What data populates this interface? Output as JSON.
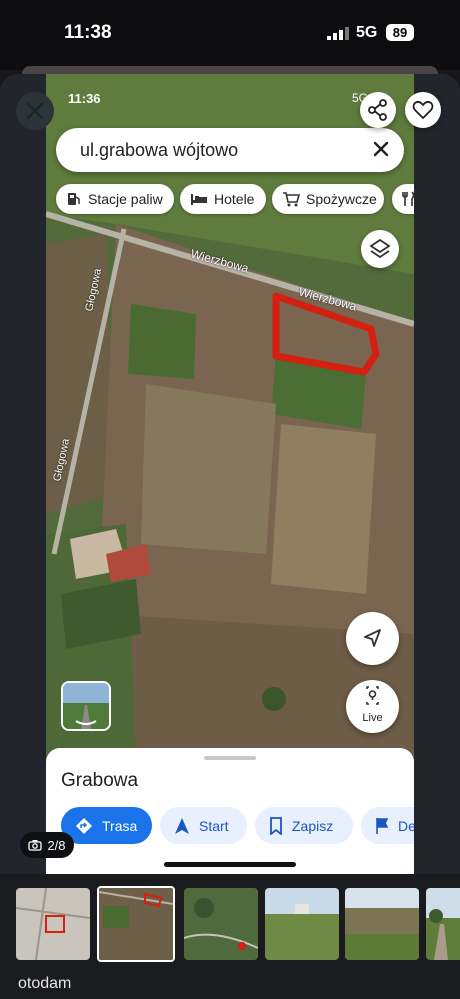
{
  "status_bar": {
    "time": "11:38",
    "network": "5G",
    "battery": "89"
  },
  "gallery": {
    "counter": "2/8",
    "brand": "otodam"
  },
  "screenshot": {
    "inner_time": "11:36",
    "inner_network": "5G",
    "search": {
      "value": "ul.grabowa wójtowo"
    },
    "chips": [
      {
        "label": "Stacje paliw",
        "icon": "gas-station-icon"
      },
      {
        "label": "Hotele",
        "icon": "bed-icon"
      },
      {
        "label": "Spożywcze",
        "icon": "cart-icon"
      },
      {
        "label": "",
        "icon": "restaurant-icon"
      }
    ],
    "map": {
      "streets": [
        "Wierzbowa",
        "Wierzbowa",
        "Głogowa",
        "Głogowa"
      ],
      "boundary_color": "#d32011"
    },
    "live_label": "Live",
    "sheet": {
      "title": "Grabowa",
      "actions": [
        {
          "label": "Trasa",
          "icon": "directions-icon"
        },
        {
          "label": "Start",
          "icon": "navigation-arrow-icon"
        },
        {
          "label": "Zapisz",
          "icon": "bookmark-icon"
        },
        {
          "label": "De",
          "icon": "flag-icon"
        }
      ]
    }
  },
  "colors": {
    "accent": "#1a73e8",
    "field_green": "#4a6a32",
    "field_brown": "#7a6650"
  }
}
